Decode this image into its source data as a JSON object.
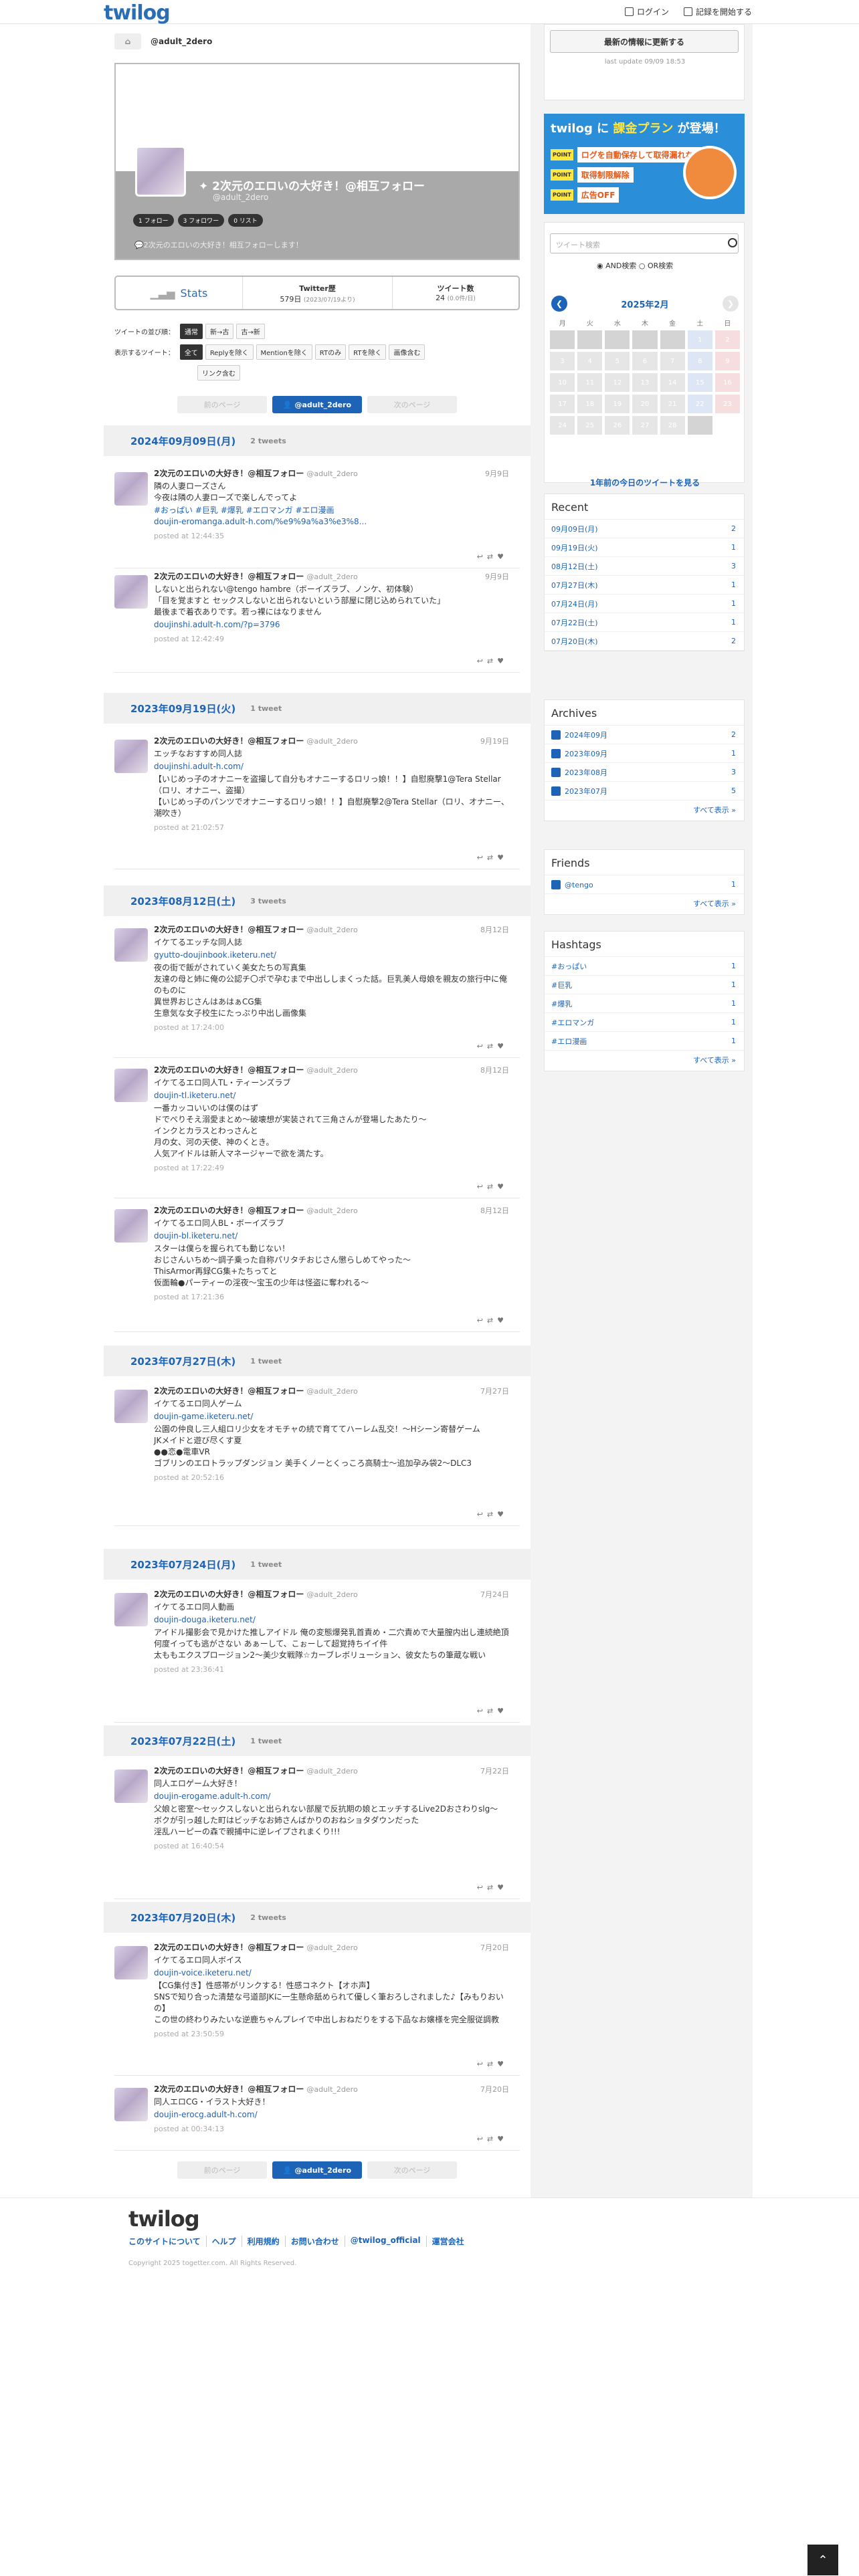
{
  "header": {
    "logo": "twilog",
    "login": "ログイン",
    "start": "記録を開始する"
  },
  "breadcrumb": {
    "user": "@adult_2dero"
  },
  "profile": {
    "name": "2次元のエロいの大好き！@相互フォロー",
    "handle": "@adult_2dero",
    "follows": "1 フォロー",
    "followers": "3 フォロワー",
    "lists": "0 リスト",
    "bio": "2次元のエロいの大好き！相互フォローします！"
  },
  "stats": {
    "label": "Stats",
    "twitter_label": "Twitter歴",
    "twitter_value": "579日",
    "twitter_sub": "(2023/07/19より)",
    "tweets_label": "ツイート数",
    "tweets_value": "24",
    "tweets_sub": "(0.0件/日)"
  },
  "filters": {
    "order_label": "ツイートの並び順：",
    "order": [
      "通常",
      "新→古",
      "古→新"
    ],
    "show_label": "表示するツイート：",
    "show": [
      "全て",
      "Replyを除く",
      "Mentionを除く",
      "RTのみ",
      "RTを除く",
      "画像含む",
      "リンク含む"
    ]
  },
  "pager": {
    "prev": "前のページ",
    "current": "@adult_2dero",
    "next": "次のページ"
  },
  "days": [
    {
      "date": "2024年09月09日(月)",
      "count": "2 tweets"
    },
    {
      "date": "2023年09月19日(火)",
      "count": "1 tweet"
    },
    {
      "date": "2023年08月12日(土)",
      "count": "3 tweets"
    },
    {
      "date": "2023年07月27日(木)",
      "count": "1 tweet"
    },
    {
      "date": "2023年07月24日(月)",
      "count": "1 tweet"
    },
    {
      "date": "2023年07月22日(土)",
      "count": "1 tweet"
    },
    {
      "date": "2023年07月20日(木)",
      "count": "2 tweets"
    }
  ],
  "tweets": [
    {
      "name": "2次元のエロいの大好き！@相互フォロー",
      "sid": "@adult_2dero",
      "date": "9月9日",
      "text": "隣の人妻ローズさん\n今夜は隣の人妻ローズで楽しんでってよ",
      "link": "#おっぱい #巨乳 #爆乳 #エロマンガ #エロ漫画\ndoujin-eromanga.adult-h.com/%e9%9a%a3%e3%8...",
      "time": "posted at 12:44:35"
    },
    {
      "name": "2次元のエロいの大好き！@相互フォロー",
      "sid": "@adult_2dero",
      "date": "9月9日",
      "text": "しないと出られない@tengo hambre（ボーイズラブ、ノンケ、初体験）\n「目を覚ますと セックスしないと出られないという部屋に閉じ込められていた」\n最後まで着衣ありです。若っ裸にはなりません",
      "link": "doujinshi.adult-h.com/?p=3796",
      "time": "posted at 12:42:49"
    },
    {
      "name": "2次元のエロいの大好き！@相互フォロー",
      "sid": "@adult_2dero",
      "date": "9月19日",
      "text": "エッチなおすすめ同人誌",
      "link": "doujinshi.adult-h.com/",
      "text2": "【いじめっ子のオナニーを盗撮して自分もオナニーするロリっ娘！！】自慰廃撃1@Tera Stellar（ロリ、オナニー、盗撮）\n【いじめっ子のパンツでオナニーするロリっ娘！！】自慰廃撃2@Tera Stellar（ロリ、オナニー、潮吹き）",
      "time": "posted at 21:02:57"
    },
    {
      "name": "2次元のエロいの大好き！@相互フォロー",
      "sid": "@adult_2dero",
      "date": "8月12日",
      "text": "イケてるエッチな同人誌",
      "link": "gyutto-doujinbook.ikete­ru.net/",
      "text2": "夜の街で飯がされていく美女たちの写真集\n友達の母と姉に俺の公認チ〇ポで孕むまで中出ししまくった話。巨乳美人母娘を親友の旅行中に俺のものに\n異世界おじさんはあはぁCG集\n生意気な女子校生にたっぷり中出し画像集",
      "time": "posted at 17:24:00"
    },
    {
      "name": "2次元のエロいの大好き！@相互フォロー",
      "sid": "@adult_2dero",
      "date": "8月12日",
      "text": "イケてるエロ同人TL・ティーンズラブ",
      "link": "doujin-tl.iketeru.net/",
      "text2": "一番カッコいいのは僕のはず\nドでぺりそえ溺愛まとめ〜破壊想が実装されて三角さんが登場したあたり〜\nインクとカラスとわっさんと\n月の女、河の天使、神のくとき。\n人気アイドルは新人マネージャーで欲を満たす。",
      "time": "posted at 17:22:49"
    },
    {
      "name": "2次元のエロいの大好き！@相互フォロー",
      "sid": "@adult_2dero",
      "date": "8月12日",
      "text": "イケてるエロ同人BL・ボーイズラブ",
      "link": "doujin-bl.iketeru.net/",
      "text2": "スターは僕らを握られても動じない！\nおじさんいちめ〜調子乗った自称パリタチおじさん懲らしめてやった〜\nThisArmor再録CG集+たちってと\n仮面輪●パーティーの淫夜〜宝玉の少年は怪盗に奪われる〜",
      "time": "posted at 17:21:36"
    },
    {
      "name": "2次元のエロいの大好き！@相互フォロー",
      "sid": "@adult_2dero",
      "date": "7月27日",
      "text": "イケてるエロ同人ゲーム",
      "link": "doujin-game.iketeru.net/",
      "text2": "公園の仲良し三人組ロリ少女をオモチャの続で育ててハーレム乱交！〜Hシーン寄替ゲーム\nJKメイドと遊び尽くす夏\n●●恋●電車VR\nゴブリンのエロトラップダンジョン 美手くノーとくっころ高騎士〜追加孕み袋2〜DLC3",
      "time": "posted at 20:52:16"
    },
    {
      "name": "2次元のエロいの大好き！@相互フォロー",
      "sid": "@adult_2dero",
      "date": "7月24日",
      "text": "イケてるエロ同人動画",
      "link": "doujin-douga.iketeru.net/",
      "text2": "アイドル撮影会で見かけた推しアイドル 俺の変態爆発乳首責め・二穴責めで大量膣内出し連続絶頂 何度イっても逃がさない あぁーして、こぉーして超覚持ちイイ件\n太ももエクスプロージョン2〜美少女戦隊☆カーブレボリューション、彼女たちの筆蔵な戦い",
      "time": "posted at 23:36:41"
    },
    {
      "name": "2次元のエロいの大好き！@相互フォロー",
      "sid": "@adult_2dero",
      "date": "7月22日",
      "text": "同人エロゲーム大好き！",
      "link": "doujin-erogame.adult-h.com/",
      "text2": "父娘と密室〜セックスしないと出られない部屋で反抗期の娘とエッチするLive2Dおさわりslg〜\nボクが引っ越した町はビッチなお姉さんばかりのおねショタダウンだった\n淫乱ハーピーの森で親捕中に逆レイプされまくり!!!",
      "time": "posted at 16:40:54"
    },
    {
      "name": "2次元のエロいの大好き！@相互フォロー",
      "sid": "@adult_2dero",
      "date": "7月20日",
      "text": "イケてるエロ同人ボイス",
      "link": "doujin-voice.iketeru.net/",
      "text2": "【CG集付き】性感帯がリンクする！性感コネクト【オホ声】\nSNSで知り合った清楚な弓道部JKに一生懸命舐められて優しく筆おろしされました♪【みもりおいの】\nこの世の終わりみたいな逆鹿ちゃんプレイで中出しおねだりをする下品なお嬢様を完全服従調教",
      "time": "posted at 23:50:59"
    },
    {
      "name": "2次元のエロいの大好き！@相互フォロー",
      "sid": "@adult_2dero",
      "date": "7月20日",
      "text": "同人エロCG・イラスト大好き！",
      "link": "doujin-erocg.adult-h.com/",
      "time": "posted at 00:34:13"
    }
  ],
  "sidebar": {
    "refresh": "最新の情報に更新する",
    "last_update": "last update 09/09 18:53",
    "banner": {
      "title_a": "twilog に ",
      "title_b": "課金プラン",
      "title_c": " が登場！",
      "point": "POINT",
      "p1_label": "ログを自動保存して取得漏れなし",
      "p2_label": "取得制限解除",
      "p3_label": "広告OFF"
    },
    "search": {
      "placeholder": "ツイート検索",
      "and": "AND検索",
      "or": "OR検索"
    },
    "calendar": {
      "title": "2025年2月",
      "weekdays": [
        "月",
        "火",
        "水",
        "木",
        "金",
        "土",
        "日"
      ],
      "days": [
        "",
        "",
        "",
        "",
        "",
        "1",
        "2",
        "3",
        "4",
        "5",
        "6",
        "7",
        "8",
        "9",
        "10",
        "11",
        "12",
        "13",
        "14",
        "15",
        "16",
        "17",
        "18",
        "19",
        "20",
        "21",
        "22",
        "23",
        "24",
        "25",
        "26",
        "27",
        "28",
        ""
      ],
      "link": "1年前の今日のツイートを見る"
    },
    "recent": {
      "title": "Recent",
      "items": [
        {
          "l": "09月09日(月)",
          "n": "2"
        },
        {
          "l": "09月19日(火)",
          "n": "1"
        },
        {
          "l": "08月12日(土)",
          "n": "3"
        },
        {
          "l": "07月27日(木)",
          "n": "1"
        },
        {
          "l": "07月24日(月)",
          "n": "1"
        },
        {
          "l": "07月22日(土)",
          "n": "1"
        },
        {
          "l": "07月20日(木)",
          "n": "2"
        }
      ]
    },
    "archives": {
      "title": "Archives",
      "items": [
        {
          "l": "2024年09月",
          "n": "2"
        },
        {
          "l": "2023年09月",
          "n": "1"
        },
        {
          "l": "2023年08月",
          "n": "3"
        },
        {
          "l": "2023年07月",
          "n": "5"
        }
      ],
      "more": "すべて表示 »"
    },
    "friends": {
      "title": "Friends",
      "items": [
        {
          "l": "@tengo",
          "n": "1"
        }
      ],
      "more": "すべて表示 »"
    },
    "hashtags": {
      "title": "Hashtags",
      "items": [
        {
          "l": "#おっぱい",
          "n": "1"
        },
        {
          "l": "#巨乳",
          "n": "1"
        },
        {
          "l": "#爆乳",
          "n": "1"
        },
        {
          "l": "#エロマンガ",
          "n": "1"
        },
        {
          "l": "#エロ漫画",
          "n": "1"
        }
      ],
      "more": "すべて表示 »"
    }
  },
  "footer": {
    "logo": "twilog",
    "links": [
      "このサイトについて",
      "ヘルプ",
      "利用規約",
      "お問い合わせ",
      "@twilog_official",
      "運営会社"
    ],
    "copyright": "Copyright 2025 togetter.com. All Rights Reserved."
  }
}
